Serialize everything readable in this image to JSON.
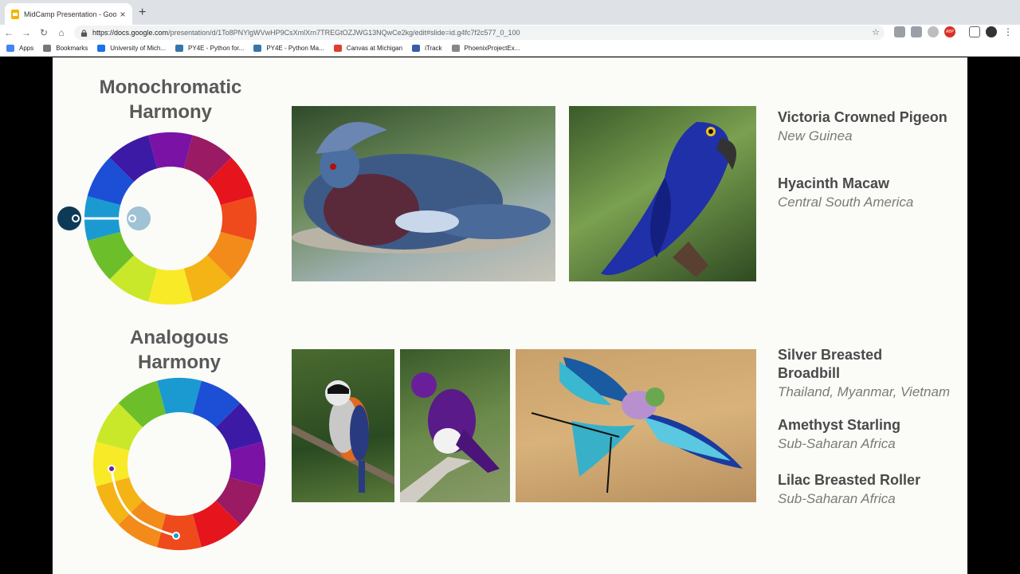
{
  "browser": {
    "tab_title": "MidCamp Presentation - Googl",
    "close_glyph": "×",
    "new_tab_glyph": "+",
    "url_host": "https://docs.google.com",
    "url_rest": "/presentation/d/1To8PNYlgWVwHP9CsXmlXrn7TREGtOZJWG13NQwCe2kg/edit#slide=id.g4fc7f2c577_0_100",
    "nav": {
      "back": "←",
      "forward": "→",
      "reload": "↻",
      "home": "⌂"
    },
    "star_glyph": "☆",
    "menu_glyph": "⋮",
    "ext_badge": "ABP",
    "bookmarks": [
      {
        "label": "Apps",
        "icon": "apps-icon",
        "color": "#4285f4"
      },
      {
        "label": "Bookmarks",
        "icon": "folder-icon",
        "color": "#777777"
      },
      {
        "label": "University of Mich...",
        "icon": "link-icon",
        "color": "#1a73e8"
      },
      {
        "label": "PY4E - Python for...",
        "icon": "python-icon",
        "color": "#3776ab"
      },
      {
        "label": "PY4E - Python Ma...",
        "icon": "python-icon",
        "color": "#3776ab"
      },
      {
        "label": "Canvas at Michigan",
        "icon": "canvas-icon",
        "color": "#e13f2b"
      },
      {
        "label": "iTrack",
        "icon": "itrack-icon",
        "color": "#3b5bab"
      },
      {
        "label": "PhoenixProjectEx...",
        "icon": "page-icon",
        "color": "#888888"
      }
    ]
  },
  "slide": {
    "mono_title_1": "Monochromatic",
    "mono_title_2": "Harmony",
    "analog_title_1": "Analogous",
    "analog_title_2": "Harmony",
    "birds_top": [
      {
        "name": "Victoria Crowned Pigeon",
        "region": "New Guinea"
      },
      {
        "name": "Hyacinth Macaw",
        "region": "Central South America"
      }
    ],
    "birds_bottom": [
      {
        "name_1": "Silver Breasted",
        "name_2": "Broadbill",
        "region": "Thailand, Myanmar, Vietnam"
      },
      {
        "name": "Amethyst Starling",
        "region": "Sub-Saharan Africa"
      },
      {
        "name": "Lilac Breasted Roller",
        "region": "Sub-Saharan Africa"
      }
    ]
  },
  "colors": {
    "wheel": [
      "#7b12a6",
      "#9a1a63",
      "#e6141d",
      "#ef4a1c",
      "#f38b1a",
      "#f5b416",
      "#f9ea28",
      "#c9e82a",
      "#6cbf2a",
      "#1a9ad1",
      "#1c4fd6",
      "#3c1aa5"
    ]
  }
}
